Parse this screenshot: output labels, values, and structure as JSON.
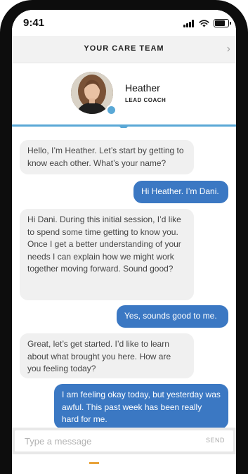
{
  "status_bar": {
    "time": "9:41"
  },
  "header": {
    "title": "YOUR CARE TEAM"
  },
  "coach": {
    "name": "Heather",
    "role": "LEAD COACH"
  },
  "messages": [
    {
      "from": "coach",
      "text": "Hello, I’m Heather. Let’s start by getting to know each other. What’s your name?"
    },
    {
      "from": "user",
      "text": "Hi Heather. I’m Dani."
    },
    {
      "from": "coach",
      "text": "Hi Dani. During this initial session, I’d like to spend some time getting to know you. Once I get a better understanding of your needs I can explain how we might work together moving forward. Sound good?"
    },
    {
      "from": "user",
      "text": "Yes, sounds good to me."
    },
    {
      "from": "coach",
      "text": "Great, let’s get started. I’d like to learn about what brought you here. How are you feeling today?"
    },
    {
      "from": "user",
      "text": "I am feeling okay today, but yesterday was awful. This past week has been really hard for me."
    }
  ],
  "composer": {
    "placeholder": "Type a message",
    "send_label": "SEND"
  },
  "colors": {
    "accent_blue": "#3b78c3",
    "divider_blue": "#5aa8d6",
    "incoming_bubble": "#f0f0f0",
    "tab_indicator": "#e8a23a"
  }
}
